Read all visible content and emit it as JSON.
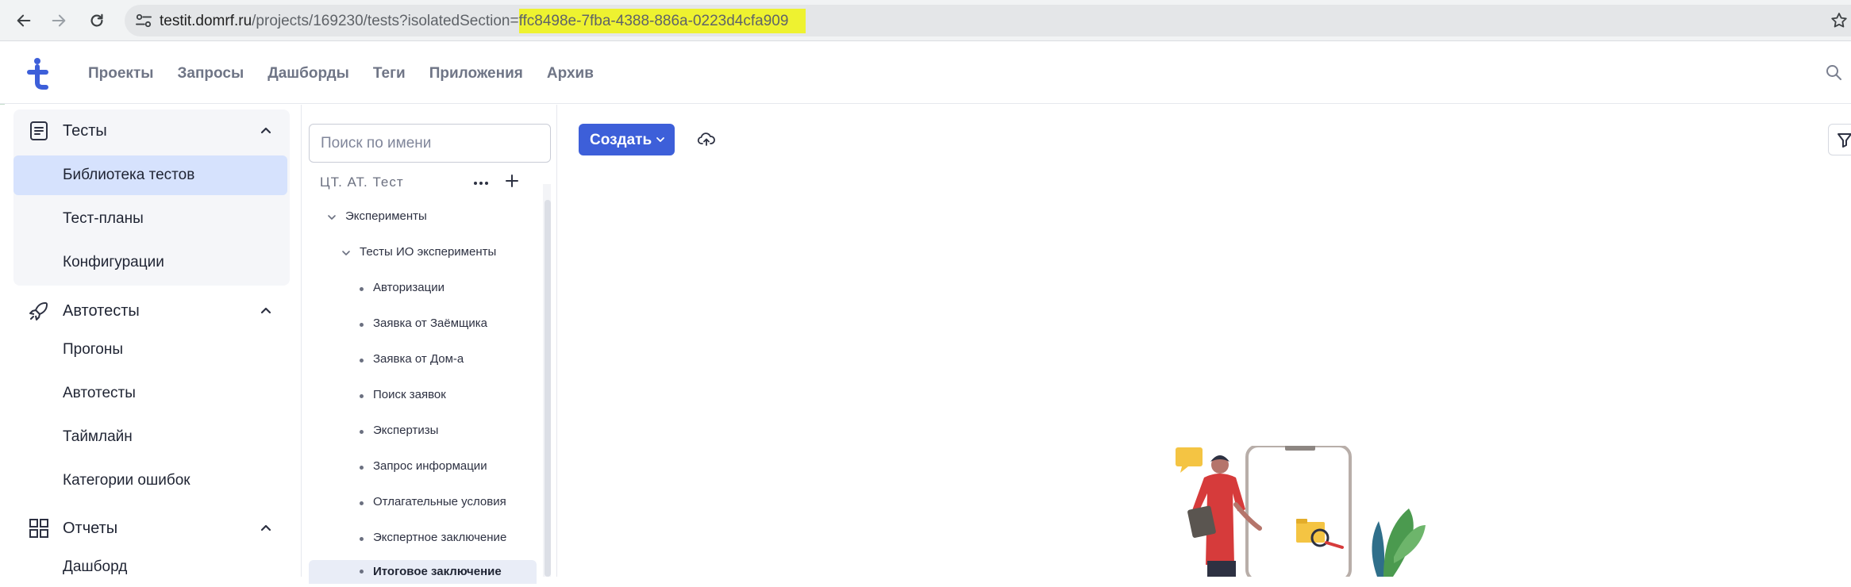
{
  "browser": {
    "url_host": "testit.domrf.ru",
    "url_path": "/projects/169230/tests?isolatedSection=",
    "url_highlight": "ffc8498e-7fba-4388-886a-0223d4cfa909"
  },
  "header": {
    "nav": [
      "Проекты",
      "Запросы",
      "Дашборды",
      "Теги",
      "Приложения",
      "Архив"
    ]
  },
  "sidebar": {
    "tests": {
      "title": "Тесты",
      "items": [
        "Библиотека тестов",
        "Тест-планы",
        "Конфигурации"
      ],
      "active_index": 0
    },
    "autotests": {
      "title": "Автотесты",
      "items": [
        "Прогоны",
        "Автотесты",
        "Таймлайн",
        "Категории ошибок"
      ]
    },
    "reports": {
      "title": "Отчеты",
      "items": [
        "Дашборд"
      ]
    }
  },
  "tree": {
    "search_placeholder": "Поиск по имени",
    "root_label": "ЦТ. АТ. Тест",
    "nodes": [
      {
        "label": "Эксперименты",
        "level": 0,
        "expandable": true
      },
      {
        "label": "Тесты ИО эксперименты",
        "level": 1,
        "expandable": true
      },
      {
        "label": "Авторизации",
        "level": 2
      },
      {
        "label": "Заявка от Заёмщика",
        "level": 2
      },
      {
        "label": "Заявка от Дом-а",
        "level": 2
      },
      {
        "label": "Поиск заявок",
        "level": 2
      },
      {
        "label": "Экспертизы",
        "level": 2
      },
      {
        "label": "Запрос информации",
        "level": 2
      },
      {
        "label": "Отлагательные условия",
        "level": 2
      },
      {
        "label": "Экспертное заключение",
        "level": 2
      },
      {
        "label": "Итоговое заключение",
        "level": 2,
        "selected": true
      }
    ]
  },
  "main": {
    "create_label": "Создать"
  },
  "colors": {
    "accent": "#3d5fd9",
    "active_bg": "#d6e2fd",
    "url_highlight": "#eef230"
  }
}
